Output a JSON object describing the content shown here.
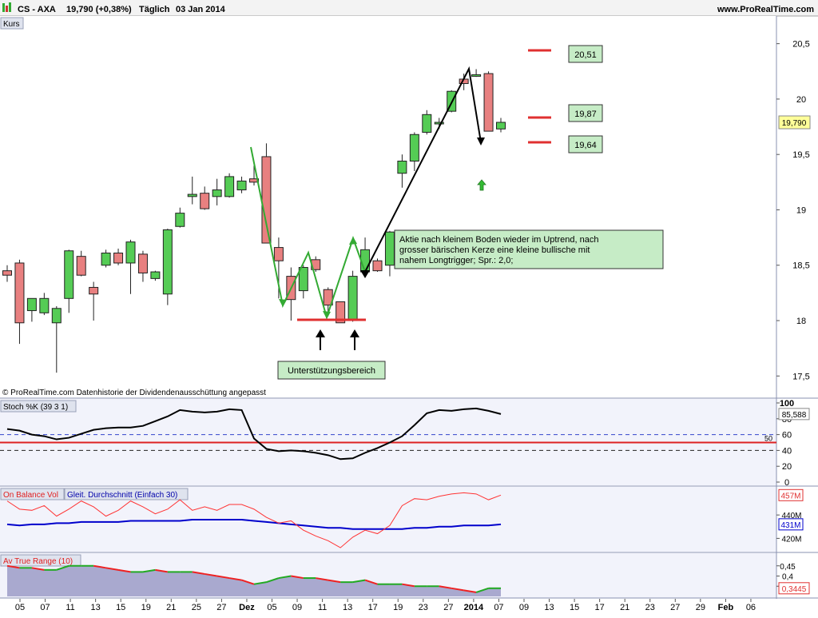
{
  "header": {
    "instrument": "CS - AXA",
    "price": "19,790 (+0,38%)",
    "period": "Täglich",
    "date": "03 Jan 2014",
    "website": "www.ProRealTime.com"
  },
  "panels": {
    "price_label": "Kurs",
    "copyright": "© ProRealTime.com  Datenhistorie der Dividendenausschüttung angepasst",
    "stoch_label": "Stoch %K (39 3 1)",
    "obv_label": "On Balance Vol",
    "obv_ma_label": "Gleit. Durchschnitt (Einfach 30)",
    "atr_label": "Av True Range (10)"
  },
  "annotations": {
    "levels": [
      "20,51",
      "19,87",
      "19,64"
    ],
    "comment": "Aktie nach kleinem Boden wieder im Uptrend, nach grosser bärischen Kerze eine kleine bullische mit nahem Longtrigger; Spr.: 2,0;",
    "support": "Unterstützungsbereich"
  },
  "colors": {
    "up": "#55cc55",
    "down": "#e88080",
    "panel_bg": "#f2f3fb",
    "line_black": "#000000",
    "trend_green": "#33aa33",
    "level_red": "#e03030",
    "label_green_bg": "#c6ecc6",
    "obv_line": "#ff3333",
    "obv_ma": "#0000cc"
  },
  "chart_data": [
    {
      "type": "candlestick",
      "title": "CS - AXA",
      "ylim": [
        17.3,
        20.75
      ],
      "yticks": [
        "20,5",
        "20",
        "19,5",
        "19",
        "18,5",
        "18",
        "17,5"
      ],
      "last_value_label": "19,790",
      "x_labels": [
        "05",
        "07",
        "11",
        "13",
        "15",
        "19",
        "21",
        "25",
        "27",
        "Dez",
        "05",
        "09",
        "11",
        "13",
        "17",
        "19",
        "23",
        "27",
        "2014",
        "07",
        "09",
        "13",
        "15",
        "17",
        "21",
        "23",
        "27",
        "29",
        "Feb",
        "06"
      ],
      "candles": [
        {
          "o": 18.45,
          "h": 18.5,
          "l": 18.35,
          "c": 18.41
        },
        {
          "o": 18.52,
          "h": 18.55,
          "l": 17.79,
          "c": 17.98
        },
        {
          "o": 18.09,
          "h": 18.2,
          "l": 17.99,
          "c": 18.2
        },
        {
          "o": 18.07,
          "h": 18.25,
          "l": 18.05,
          "c": 18.2
        },
        {
          "o": 17.98,
          "h": 18.13,
          "l": 17.53,
          "c": 18.11
        },
        {
          "o": 18.2,
          "h": 18.64,
          "l": 18.07,
          "c": 18.63
        },
        {
          "o": 18.58,
          "h": 18.63,
          "l": 18.4,
          "c": 18.41
        },
        {
          "o": 18.3,
          "h": 18.35,
          "l": 18.0,
          "c": 18.24
        },
        {
          "o": 18.5,
          "h": 18.64,
          "l": 18.48,
          "c": 18.61
        },
        {
          "o": 18.61,
          "h": 18.65,
          "l": 18.5,
          "c": 18.52
        },
        {
          "o": 18.52,
          "h": 18.73,
          "l": 18.24,
          "c": 18.71
        },
        {
          "o": 18.6,
          "h": 18.63,
          "l": 18.35,
          "c": 18.43
        },
        {
          "o": 18.38,
          "h": 18.45,
          "l": 18.36,
          "c": 18.44
        },
        {
          "o": 18.24,
          "h": 18.83,
          "l": 18.14,
          "c": 18.82
        },
        {
          "o": 18.85,
          "h": 19.02,
          "l": 18.84,
          "c": 18.97
        },
        {
          "o": 19.12,
          "h": 19.3,
          "l": 19.05,
          "c": 19.14
        },
        {
          "o": 19.15,
          "h": 19.21,
          "l": 19.0,
          "c": 19.01
        },
        {
          "o": 19.12,
          "h": 19.28,
          "l": 19.04,
          "c": 19.18
        },
        {
          "o": 19.12,
          "h": 19.33,
          "l": 19.11,
          "c": 19.3
        },
        {
          "o": 19.18,
          "h": 19.3,
          "l": 19.15,
          "c": 19.26
        },
        {
          "o": 19.28,
          "h": 19.4,
          "l": 19.22,
          "c": 19.25
        },
        {
          "o": 19.48,
          "h": 19.6,
          "l": 18.7,
          "c": 18.7
        },
        {
          "o": 18.66,
          "h": 18.75,
          "l": 18.2,
          "c": 18.54
        },
        {
          "o": 18.4,
          "h": 18.48,
          "l": 18.0,
          "c": 18.19
        },
        {
          "o": 18.27,
          "h": 18.5,
          "l": 18.2,
          "c": 18.48
        },
        {
          "o": 18.55,
          "h": 18.58,
          "l": 18.44,
          "c": 18.46
        },
        {
          "o": 18.28,
          "h": 18.3,
          "l": 18.04,
          "c": 18.14
        },
        {
          "o": 18.17,
          "h": 18.17,
          "l": 17.98,
          "c": 17.98
        },
        {
          "o": 18.0,
          "h": 18.45,
          "l": 17.99,
          "c": 18.4
        },
        {
          "o": 18.44,
          "h": 18.75,
          "l": 18.4,
          "c": 18.64
        },
        {
          "o": 18.54,
          "h": 18.56,
          "l": 18.44,
          "c": 18.45
        },
        {
          "o": 18.5,
          "h": 18.81,
          "l": 18.4,
          "c": 18.8
        },
        {
          "o": 19.33,
          "h": 19.5,
          "l": 19.2,
          "c": 19.44
        },
        {
          "o": 19.44,
          "h": 19.7,
          "l": 19.35,
          "c": 19.68
        },
        {
          "o": 19.7,
          "h": 19.9,
          "l": 19.68,
          "c": 19.86
        },
        {
          "o": 19.79,
          "h": 19.83,
          "l": 19.73,
          "c": 19.79
        },
        {
          "o": 19.89,
          "h": 20.08,
          "l": 19.88,
          "c": 20.07
        },
        {
          "o": 20.18,
          "h": 20.23,
          "l": 20.08,
          "c": 20.14
        },
        {
          "o": 20.22,
          "h": 20.27,
          "l": 20.2,
          "c": 20.22
        },
        {
          "o": 20.23,
          "h": 20.25,
          "l": 19.71,
          "c": 19.71
        },
        {
          "o": 19.73,
          "h": 19.83,
          "l": 19.7,
          "c": 19.79
        }
      ]
    },
    {
      "type": "line",
      "title": "Stoch %K (39 3 1)",
      "ylim": [
        0,
        100
      ],
      "yticks": [
        "100",
        "80",
        "60",
        "40",
        "20",
        "0"
      ],
      "level_labels": [
        "50"
      ],
      "last_value_label": "85,588",
      "values": [
        67,
        65,
        60,
        58,
        54,
        56,
        61,
        66,
        68,
        69,
        69,
        71,
        77,
        83,
        91,
        89,
        88,
        89,
        92,
        91,
        55,
        42,
        39,
        40,
        39,
        37,
        34,
        29,
        30,
        37,
        43,
        50,
        58,
        72,
        87,
        91,
        90,
        92,
        93,
        90,
        86
      ],
      "dashed_levels": [
        60,
        40
      ],
      "solid_level": 50
    },
    {
      "type": "line",
      "series": [
        {
          "name": "On Balance Vol",
          "values": [
            452,
            445,
            444,
            448,
            439,
            445,
            452,
            447,
            439,
            444,
            452,
            447,
            441,
            445,
            453,
            444,
            447,
            444,
            449,
            449,
            445,
            438,
            433,
            435,
            427,
            422,
            418,
            412,
            421,
            427,
            424,
            431,
            448,
            454,
            453,
            456,
            458,
            459,
            458,
            453,
            457
          ]
        },
        {
          "name": "Gleit. Durchschnitt (Einfach 30)",
          "values": [
            432,
            431,
            432,
            432,
            433,
            433,
            434,
            434,
            434,
            434,
            435,
            435,
            435,
            435,
            435,
            436,
            436,
            436,
            436,
            436,
            435,
            434,
            433,
            432,
            431,
            430,
            429,
            429,
            428,
            428,
            428,
            428,
            428,
            429,
            429,
            430,
            430,
            431,
            431,
            431,
            432
          ]
        }
      ],
      "ylim": [
        410,
        462
      ],
      "yticks": [
        "440M",
        "420M"
      ],
      "last_value_labels": [
        "457M",
        "431M"
      ]
    },
    {
      "type": "area",
      "title": "Av True Range (10)",
      "ylim": [
        0.3,
        0.5
      ],
      "yticks": [
        "0,45",
        "0,4",
        "0,35"
      ],
      "last_value_label": "0,3445",
      "values": [
        0.45,
        0.44,
        0.44,
        0.43,
        0.43,
        0.45,
        0.45,
        0.45,
        0.44,
        0.43,
        0.42,
        0.42,
        0.43,
        0.42,
        0.42,
        0.42,
        0.41,
        0.4,
        0.39,
        0.38,
        0.36,
        0.37,
        0.39,
        0.4,
        0.39,
        0.39,
        0.38,
        0.37,
        0.37,
        0.38,
        0.36,
        0.36,
        0.36,
        0.35,
        0.35,
        0.35,
        0.34,
        0.33,
        0.32,
        0.34,
        0.34
      ],
      "colors_by_direction": [
        "green",
        "red"
      ]
    }
  ]
}
